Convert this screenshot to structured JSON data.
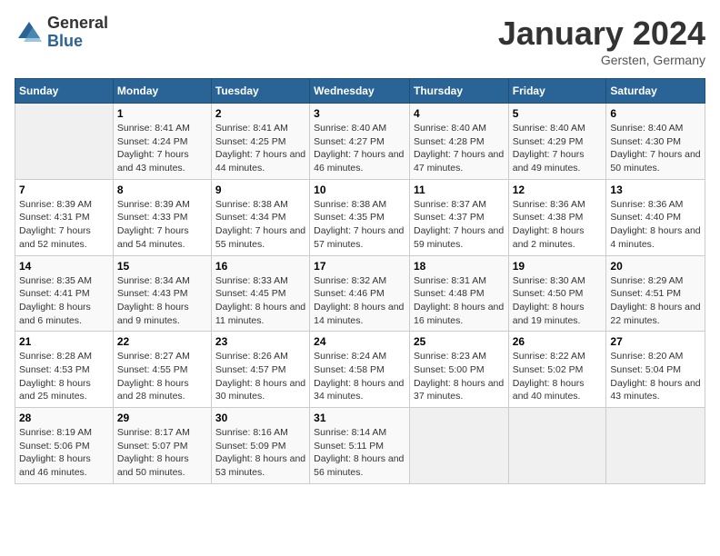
{
  "logo": {
    "general": "General",
    "blue": "Blue"
  },
  "header": {
    "month": "January 2024",
    "location": "Gersten, Germany"
  },
  "weekdays": [
    "Sunday",
    "Monday",
    "Tuesday",
    "Wednesday",
    "Thursday",
    "Friday",
    "Saturday"
  ],
  "weeks": [
    [
      {
        "day": "",
        "empty": true
      },
      {
        "day": "1",
        "sunrise": "Sunrise: 8:41 AM",
        "sunset": "Sunset: 4:24 PM",
        "daylight": "Daylight: 7 hours and 43 minutes."
      },
      {
        "day": "2",
        "sunrise": "Sunrise: 8:41 AM",
        "sunset": "Sunset: 4:25 PM",
        "daylight": "Daylight: 7 hours and 44 minutes."
      },
      {
        "day": "3",
        "sunrise": "Sunrise: 8:40 AM",
        "sunset": "Sunset: 4:27 PM",
        "daylight": "Daylight: 7 hours and 46 minutes."
      },
      {
        "day": "4",
        "sunrise": "Sunrise: 8:40 AM",
        "sunset": "Sunset: 4:28 PM",
        "daylight": "Daylight: 7 hours and 47 minutes."
      },
      {
        "day": "5",
        "sunrise": "Sunrise: 8:40 AM",
        "sunset": "Sunset: 4:29 PM",
        "daylight": "Daylight: 7 hours and 49 minutes."
      },
      {
        "day": "6",
        "sunrise": "Sunrise: 8:40 AM",
        "sunset": "Sunset: 4:30 PM",
        "daylight": "Daylight: 7 hours and 50 minutes."
      }
    ],
    [
      {
        "day": "7",
        "sunrise": "Sunrise: 8:39 AM",
        "sunset": "Sunset: 4:31 PM",
        "daylight": "Daylight: 7 hours and 52 minutes."
      },
      {
        "day": "8",
        "sunrise": "Sunrise: 8:39 AM",
        "sunset": "Sunset: 4:33 PM",
        "daylight": "Daylight: 7 hours and 54 minutes."
      },
      {
        "day": "9",
        "sunrise": "Sunrise: 8:38 AM",
        "sunset": "Sunset: 4:34 PM",
        "daylight": "Daylight: 7 hours and 55 minutes."
      },
      {
        "day": "10",
        "sunrise": "Sunrise: 8:38 AM",
        "sunset": "Sunset: 4:35 PM",
        "daylight": "Daylight: 7 hours and 57 minutes."
      },
      {
        "day": "11",
        "sunrise": "Sunrise: 8:37 AM",
        "sunset": "Sunset: 4:37 PM",
        "daylight": "Daylight: 7 hours and 59 minutes."
      },
      {
        "day": "12",
        "sunrise": "Sunrise: 8:36 AM",
        "sunset": "Sunset: 4:38 PM",
        "daylight": "Daylight: 8 hours and 2 minutes."
      },
      {
        "day": "13",
        "sunrise": "Sunrise: 8:36 AM",
        "sunset": "Sunset: 4:40 PM",
        "daylight": "Daylight: 8 hours and 4 minutes."
      }
    ],
    [
      {
        "day": "14",
        "sunrise": "Sunrise: 8:35 AM",
        "sunset": "Sunset: 4:41 PM",
        "daylight": "Daylight: 8 hours and 6 minutes."
      },
      {
        "day": "15",
        "sunrise": "Sunrise: 8:34 AM",
        "sunset": "Sunset: 4:43 PM",
        "daylight": "Daylight: 8 hours and 9 minutes."
      },
      {
        "day": "16",
        "sunrise": "Sunrise: 8:33 AM",
        "sunset": "Sunset: 4:45 PM",
        "daylight": "Daylight: 8 hours and 11 minutes."
      },
      {
        "day": "17",
        "sunrise": "Sunrise: 8:32 AM",
        "sunset": "Sunset: 4:46 PM",
        "daylight": "Daylight: 8 hours and 14 minutes."
      },
      {
        "day": "18",
        "sunrise": "Sunrise: 8:31 AM",
        "sunset": "Sunset: 4:48 PM",
        "daylight": "Daylight: 8 hours and 16 minutes."
      },
      {
        "day": "19",
        "sunrise": "Sunrise: 8:30 AM",
        "sunset": "Sunset: 4:50 PM",
        "daylight": "Daylight: 8 hours and 19 minutes."
      },
      {
        "day": "20",
        "sunrise": "Sunrise: 8:29 AM",
        "sunset": "Sunset: 4:51 PM",
        "daylight": "Daylight: 8 hours and 22 minutes."
      }
    ],
    [
      {
        "day": "21",
        "sunrise": "Sunrise: 8:28 AM",
        "sunset": "Sunset: 4:53 PM",
        "daylight": "Daylight: 8 hours and 25 minutes."
      },
      {
        "day": "22",
        "sunrise": "Sunrise: 8:27 AM",
        "sunset": "Sunset: 4:55 PM",
        "daylight": "Daylight: 8 hours and 28 minutes."
      },
      {
        "day": "23",
        "sunrise": "Sunrise: 8:26 AM",
        "sunset": "Sunset: 4:57 PM",
        "daylight": "Daylight: 8 hours and 30 minutes."
      },
      {
        "day": "24",
        "sunrise": "Sunrise: 8:24 AM",
        "sunset": "Sunset: 4:58 PM",
        "daylight": "Daylight: 8 hours and 34 minutes."
      },
      {
        "day": "25",
        "sunrise": "Sunrise: 8:23 AM",
        "sunset": "Sunset: 5:00 PM",
        "daylight": "Daylight: 8 hours and 37 minutes."
      },
      {
        "day": "26",
        "sunrise": "Sunrise: 8:22 AM",
        "sunset": "Sunset: 5:02 PM",
        "daylight": "Daylight: 8 hours and 40 minutes."
      },
      {
        "day": "27",
        "sunrise": "Sunrise: 8:20 AM",
        "sunset": "Sunset: 5:04 PM",
        "daylight": "Daylight: 8 hours and 43 minutes."
      }
    ],
    [
      {
        "day": "28",
        "sunrise": "Sunrise: 8:19 AM",
        "sunset": "Sunset: 5:06 PM",
        "daylight": "Daylight: 8 hours and 46 minutes."
      },
      {
        "day": "29",
        "sunrise": "Sunrise: 8:17 AM",
        "sunset": "Sunset: 5:07 PM",
        "daylight": "Daylight: 8 hours and 50 minutes."
      },
      {
        "day": "30",
        "sunrise": "Sunrise: 8:16 AM",
        "sunset": "Sunset: 5:09 PM",
        "daylight": "Daylight: 8 hours and 53 minutes."
      },
      {
        "day": "31",
        "sunrise": "Sunrise: 8:14 AM",
        "sunset": "Sunset: 5:11 PM",
        "daylight": "Daylight: 8 hours and 56 minutes."
      },
      {
        "day": "",
        "empty": true
      },
      {
        "day": "",
        "empty": true
      },
      {
        "day": "",
        "empty": true
      }
    ]
  ]
}
